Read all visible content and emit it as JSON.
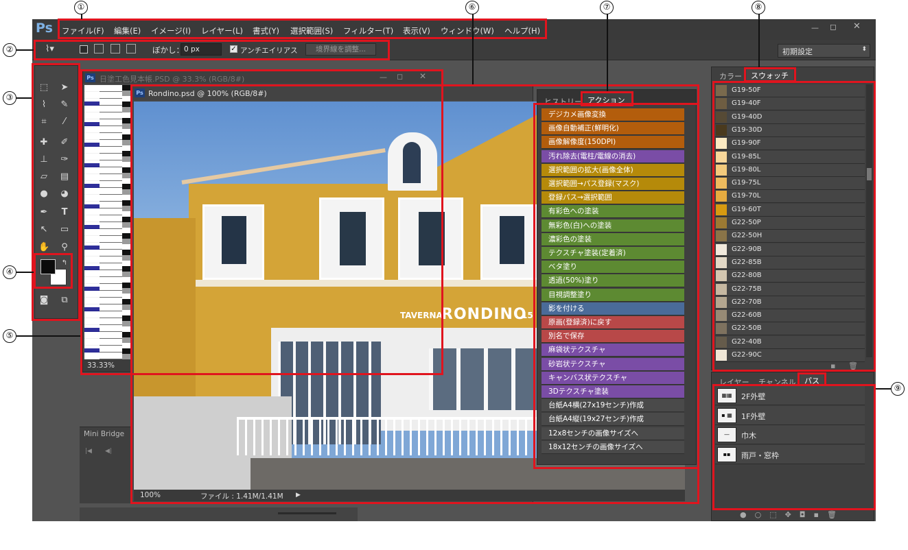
{
  "app": {
    "logo": "Ps",
    "window_buttons": [
      "—",
      "◻",
      "✕"
    ]
  },
  "menu": [
    "ファイル(F)",
    "編集(E)",
    "イメージ(I)",
    "レイヤー(L)",
    "書式(Y)",
    "選択範囲(S)",
    "フィルター(T)",
    "表示(V)",
    "ウィンドウ(W)",
    "ヘルプ(H)"
  ],
  "options_bar": {
    "feather_label": "ぼかし：",
    "feather_value": "0 px",
    "antialias_label": "アンチエイリアス",
    "refine_edge_label": "境界線を調整...",
    "workspace_preset": "初期設定"
  },
  "documents": {
    "back": {
      "title": "日塗工色見本帳.PSD @ 33.3% (RGB/8#)",
      "zoom": "33.33%"
    },
    "front": {
      "title": "Rondino.psd @ 100% (RGB/8#)",
      "zoom": "100%",
      "file_info": "ファイル : 1.41M/1.41M",
      "sign_small": "TAVERNA",
      "sign_big": "RONDINO",
      "sign_num": "15"
    }
  },
  "mini_bridge": {
    "tab": "Mini Bridge"
  },
  "actions_panel": {
    "tabs": [
      "ヒストリー",
      "アクション"
    ],
    "active_tab": "アクション",
    "items": [
      {
        "label": "デジカメ画像変換",
        "color": "#b35d0c"
      },
      {
        "label": "画像自動補正(鮮明化)",
        "color": "#b35d0c"
      },
      {
        "label": "画像解像度(150DPI)",
        "color": "#b35d0c"
      },
      {
        "label": "汚れ除去(電柱/電線の消去)",
        "color": "#7a4da6"
      },
      {
        "label": "選択範囲の拡大(画像全体)",
        "color": "#b58a0a"
      },
      {
        "label": "選択範囲→パス登録(マスク)",
        "color": "#b58a0a"
      },
      {
        "label": "登録パス→選択範囲",
        "color": "#b58a0a"
      },
      {
        "label": "有彩色への塗装",
        "color": "#5d8a32"
      },
      {
        "label": "無彩色(白)への塗装",
        "color": "#5d8a32"
      },
      {
        "label": "濃彩色の塗装",
        "color": "#5d8a32"
      },
      {
        "label": "テクスチャ塗装(定着済)",
        "color": "#5d8a32"
      },
      {
        "label": "ベタ塗り",
        "color": "#5d8a32"
      },
      {
        "label": "透過(50%)塗り",
        "color": "#5d8a32"
      },
      {
        "label": "目視調整塗り",
        "color": "#5d8a32"
      },
      {
        "label": "影を付ける",
        "color": "#4a6b99"
      },
      {
        "label": "原画(登録済)に戻す",
        "color": "#b84848"
      },
      {
        "label": "別名で保存",
        "color": "#b84848"
      },
      {
        "label": "麻袋状テクスチャ",
        "color": "#7a4da6"
      },
      {
        "label": "砂岩状テクスチャ",
        "color": "#7a4da6"
      },
      {
        "label": "キャンバス状テクスチャ",
        "color": "#7a4da6"
      },
      {
        "label": "3Dテクスチャ塗装",
        "color": "#7a4da6"
      },
      {
        "label": "台紙A4横(27x19センチ)作成",
        "color": "#4a4a4a"
      },
      {
        "label": "台紙A4縦(19x27センチ)作成",
        "color": "#4a4a4a"
      },
      {
        "label": "12x8センチの画像サイズへ",
        "color": "#4a4a4a"
      },
      {
        "label": "18x12センチの画像サイズへ",
        "color": "#4a4a4a"
      }
    ]
  },
  "swatches_panel": {
    "tabs": [
      "カラー",
      "スウォッチ"
    ],
    "active_tab": "スウォッチ",
    "items": [
      {
        "name": "G19-50F",
        "color": "#7a6a4d"
      },
      {
        "name": "G19-40F",
        "color": "#6e5d42"
      },
      {
        "name": "G19-40D",
        "color": "#564a35"
      },
      {
        "name": "G19-30D",
        "color": "#4a3a1e"
      },
      {
        "name": "G19-90F",
        "color": "#fbe9c2"
      },
      {
        "name": "G19-85L",
        "color": "#f8d79a"
      },
      {
        "name": "G19-80L",
        "color": "#f3ca7c"
      },
      {
        "name": "G19-75L",
        "color": "#eebb5e"
      },
      {
        "name": "G19-70L",
        "color": "#e6ab40"
      },
      {
        "name": "G19-60T",
        "color": "#d79a10"
      },
      {
        "name": "G22-50P",
        "color": "#9c7a33"
      },
      {
        "name": "G22-50H",
        "color": "#8a7448"
      },
      {
        "name": "G22-90B",
        "color": "#f1e9dc"
      },
      {
        "name": "G22-85B",
        "color": "#e3d8c6"
      },
      {
        "name": "G22-80B",
        "color": "#d3c6b0"
      },
      {
        "name": "G22-75B",
        "color": "#c6b8a1"
      },
      {
        "name": "G22-70B",
        "color": "#b4a68f"
      },
      {
        "name": "G22-60B",
        "color": "#978a75"
      },
      {
        "name": "G22-50B",
        "color": "#7e725f"
      },
      {
        "name": "G22-40B",
        "color": "#655b4b"
      },
      {
        "name": "G22-90C",
        "color": "#efe6d6"
      }
    ]
  },
  "paths_panel": {
    "tabs": [
      "レイヤー",
      "チャンネル",
      "パス"
    ],
    "active_tab": "パス",
    "items": [
      {
        "label": "2F外壁",
        "thumb": "▦▦"
      },
      {
        "label": "1F外壁",
        "thumb": "▪ ▦"
      },
      {
        "label": "巾木",
        "thumb": "—"
      },
      {
        "label": "雨戸・窓枠",
        "thumb": "▪▪"
      }
    ]
  },
  "callouts": [
    "①",
    "②",
    "③",
    "④",
    "⑤",
    "⑥",
    "⑦",
    "⑧",
    "⑨"
  ]
}
